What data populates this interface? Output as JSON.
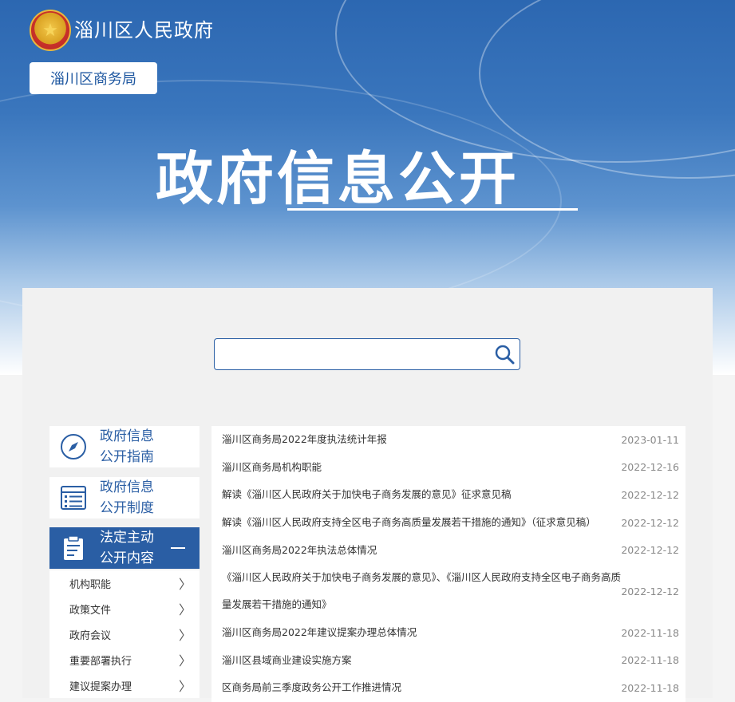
{
  "header": {
    "site_title": "淄川区人民政府",
    "department": "淄川区商务局",
    "hero_title": "政府信息公开"
  },
  "search": {
    "placeholder": "",
    "value": ""
  },
  "sidebar": {
    "cards": [
      {
        "label": "政府信息\n公开指南",
        "icon": "compass-icon"
      },
      {
        "label": "政府信息\n公开制度",
        "icon": "list-document-icon"
      }
    ],
    "active": {
      "label": "法定主动\n公开内容",
      "icon": "clipboard-icon"
    },
    "sub_items": [
      {
        "label": "机构职能"
      },
      {
        "label": "政策文件"
      },
      {
        "label": "政府会议"
      },
      {
        "label": "重要部署执行"
      },
      {
        "label": "建议提案办理"
      }
    ]
  },
  "articles": [
    {
      "title": "淄川区商务局2022年度执法统计年报",
      "date": "2023-01-11"
    },
    {
      "title": "淄川区商务局机构职能",
      "date": "2022-12-16"
    },
    {
      "title": "解读《淄川区人民政府关于加快电子商务发展的意见》征求意见稿",
      "date": "2022-12-12"
    },
    {
      "title": "解读《淄川区人民政府支持全区电子商务高质量发展若干措施的通知》（征求意见稿）",
      "date": "2022-12-12"
    },
    {
      "title": "淄川区商务局2022年执法总体情况",
      "date": "2022-12-12"
    },
    {
      "title": "《淄川区人民政府关于加快电子商务发展的意见》、《淄川区人民政府支持全区电子商务高质量发展若干措施的通知》",
      "date": "2022-12-12"
    },
    {
      "title": "淄川区商务局2022年建议提案办理总体情况",
      "date": "2022-11-18"
    },
    {
      "title": "淄川区县域商业建设实施方案",
      "date": "2022-11-18"
    },
    {
      "title": "区商务局前三季度政务公开工作推进情况",
      "date": "2022-11-18"
    }
  ]
}
